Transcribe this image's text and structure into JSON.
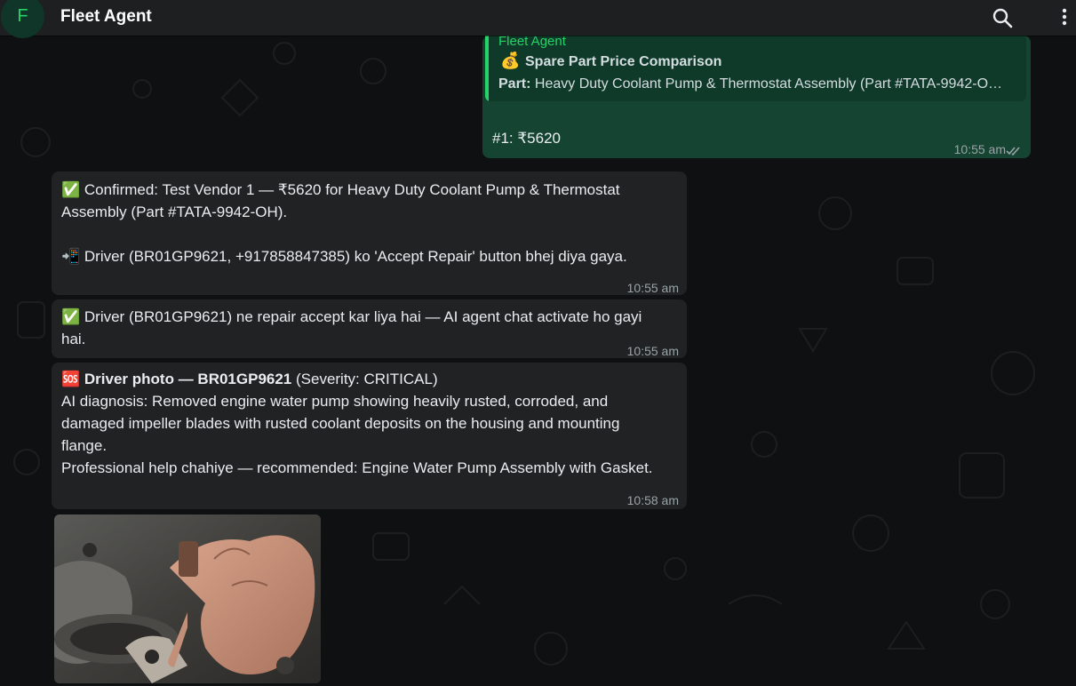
{
  "header": {
    "avatar_letter": "F",
    "title": "Fleet Agent",
    "search_icon": "search-icon",
    "menu_icon": "more-vert-icon"
  },
  "outgoing": {
    "quote": {
      "author": "Fleet Agent",
      "icon": "💰",
      "title": "Spare Part Price Comparison",
      "part_label": "Part:",
      "part_value": " Heavy Duty Coolant Pump & Thermostat Assembly (Part #TATA-9942-O…"
    },
    "text": "#1: ₹5620",
    "time": "10:55 am",
    "status_icon": "double-check-icon"
  },
  "messages": [
    {
      "lines": [
        "✅ Confirmed: Test Vendor 1 — ₹5620 for Heavy Duty Coolant Pump & Thermostat",
        "Assembly (Part #TATA-9942-OH).",
        "",
        "📲 Driver (BR01GP9621, +917858847385) ko 'Accept Repair' button bhej diya gaya."
      ],
      "time": "10:55 am"
    },
    {
      "lines": [
        "✅ Driver (BR01GP9621) ne repair accept kar liya hai — AI agent chat activate ho gayi",
        "hai."
      ],
      "time": "10:55 am"
    },
    {
      "sos_icon": "🆘",
      "bold_title": "Driver photo — BR01GP9621",
      "title_rest": " (Severity: CRITICAL)",
      "lines": [
        "AI diagnosis: Removed engine water pump showing heavily rusted, corroded, and",
        "damaged impeller blades with rusted coolant deposits on the housing and mounting",
        "flange.",
        "Professional help chahiye — recommended: Engine Water Pump Assembly with Gasket."
      ],
      "time": "10:58 am"
    }
  ],
  "colors": {
    "accent": "#25d366",
    "outgoing_bubble": "#154532",
    "incoming_bubble": "#202223",
    "background": "#0b0c0d"
  }
}
